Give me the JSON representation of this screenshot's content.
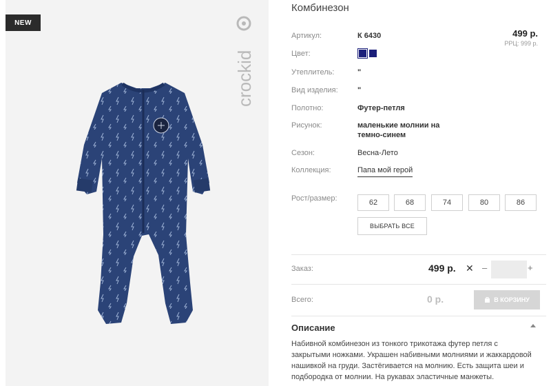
{
  "badge": "NEW",
  "brand": "crockid",
  "product": {
    "title": "Комбинезон",
    "price": "499 р.",
    "rrp": "РРЦ: 999 р.",
    "attributes": {
      "article": {
        "label": "Артикул:",
        "value": "К 6430"
      },
      "color": {
        "label": "Цвет:"
      },
      "insulation": {
        "label": "Утеплитель:",
        "value": "\""
      },
      "type": {
        "label": "Вид изделия:",
        "value": "\""
      },
      "fabric": {
        "label": "Полотно:",
        "value": "Футер-петля"
      },
      "pattern": {
        "label": "Рисунок:",
        "value_line1": "маленькие молнии на",
        "value_line2": "темно-синем"
      },
      "season": {
        "label": "Сезон:",
        "value": "Весна-Лето"
      },
      "collection": {
        "label": "Коллекция:",
        "value": "Папа мой герой"
      }
    },
    "colors": [
      "#1b1f7a",
      "#1b1f7a"
    ],
    "size_label": "Рост/размер:",
    "sizes": [
      "62",
      "68",
      "74",
      "80",
      "86"
    ],
    "select_all": "ВЫБРАТЬ ВСЕ"
  },
  "order": {
    "label": "Заказ:",
    "price": "499 р.",
    "remove": "✕",
    "minus": "–",
    "plus": "+",
    "quantity": ""
  },
  "total": {
    "label": "Всего:",
    "value": "0 р.",
    "cart_button": "В КОРЗИНУ"
  },
  "description": {
    "title": "Описание",
    "line1": "Набивной комбинезон из тонкого трикотажа футер петля с",
    "line2": "закрытыми ножками. Украшен набивными молниями и жаккардовой",
    "line3": "нашивкой на груди. Застёгивается на молнию. Есть защита шеи и",
    "line4": "подбородка от молнии. На рукавах эластичные манжеты."
  }
}
